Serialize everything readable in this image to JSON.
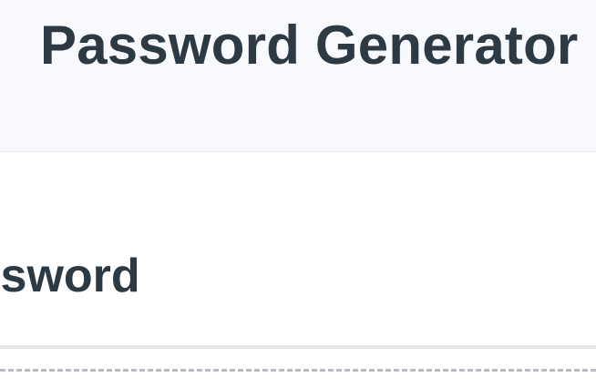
{
  "header": {
    "title": "Password Generator"
  },
  "card": {
    "title": "Password"
  },
  "colors": {
    "header_bg": "#f8f9fd",
    "text": "#2d3a44",
    "divider": "#e4e6ea",
    "dashed_border": "#b9bec4"
  }
}
